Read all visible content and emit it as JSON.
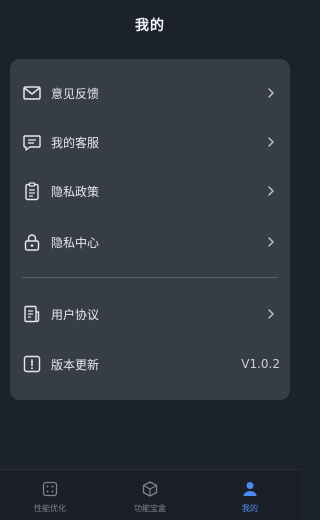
{
  "header": {
    "title": "我的"
  },
  "menu": {
    "items": [
      {
        "label": "意见反馈",
        "icon": "mail-icon"
      },
      {
        "label": "我的客服",
        "icon": "chat-icon"
      },
      {
        "label": "隐私政策",
        "icon": "clipboard-icon"
      },
      {
        "label": "隐私中心",
        "icon": "lock-icon"
      },
      {
        "label": "用户协议",
        "icon": "document-icon"
      },
      {
        "label": "版本更新",
        "icon": "alert-icon",
        "value": "V1.0.2"
      }
    ]
  },
  "bottom_nav": {
    "items": [
      {
        "label": "性能优化",
        "icon": "dice-icon",
        "active": false
      },
      {
        "label": "功能宝盒",
        "icon": "box-icon",
        "active": false
      },
      {
        "label": "我的",
        "icon": "user-icon",
        "active": true
      }
    ]
  },
  "colors": {
    "accent": "#4e8cf0",
    "card": "#373d47",
    "background": "#1c222b"
  }
}
